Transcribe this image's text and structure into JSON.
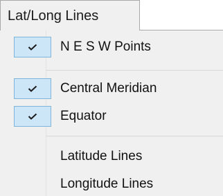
{
  "tab": {
    "label": "Lat/Long Lines"
  },
  "menu": {
    "items": [
      {
        "label": "N E S W Points",
        "checked": true
      },
      {
        "label": "Central Meridian",
        "checked": true
      },
      {
        "label": "Equator",
        "checked": true
      },
      {
        "label": "Latitude Lines",
        "checked": false
      },
      {
        "label": "Longitude Lines",
        "checked": false
      }
    ]
  },
  "colors": {
    "menu_background": "#f0f0f0",
    "check_highlight": "#cde6f7",
    "check_border": "#7fb4dd"
  }
}
